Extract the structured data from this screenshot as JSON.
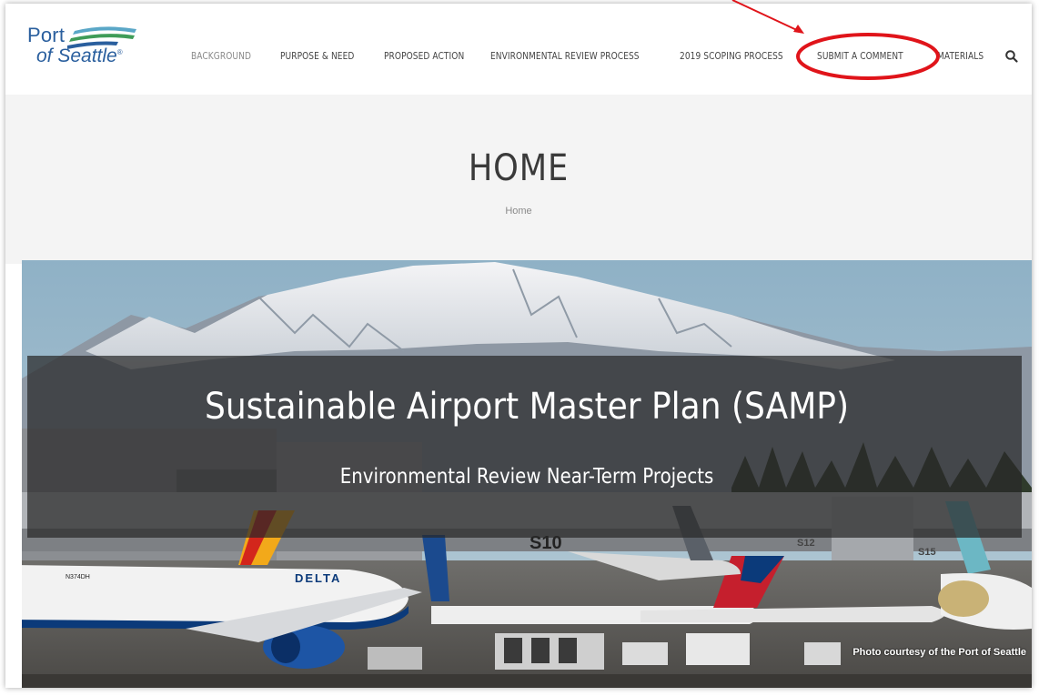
{
  "logo": {
    "line1": "Port",
    "line2": "of Seattle",
    "reg": "®"
  },
  "nav": {
    "items": [
      {
        "label": "BACKGROUND"
      },
      {
        "label": "PURPOSE & NEED"
      },
      {
        "label": "PROPOSED ACTION"
      },
      {
        "label": "ENVIRONMENTAL REVIEW PROCESS"
      },
      {
        "label": "2019 SCOPING PROCESS"
      },
      {
        "label": "SUBMIT A COMMENT"
      },
      {
        "label": "MATERIALS"
      }
    ],
    "search_icon": "search-icon"
  },
  "page": {
    "title": "HOME",
    "breadcrumb": "Home"
  },
  "hero": {
    "title": "Sustainable Airport Master Plan (SAMP)",
    "subtitle": "Environmental Review Near-Term Projects",
    "credit": "Photo courtesy of the Port of Seattle",
    "gate_label_1": "S10",
    "gate_label_2": "S12",
    "gate_label_3": "S15",
    "tail_1": "N374DH",
    "airline": "DELTA"
  },
  "colors": {
    "brand_blue": "#2a5f9e",
    "brand_green": "#3f9c58",
    "brand_teal": "#5aa7c7",
    "annotation_red": "#e0141a"
  }
}
